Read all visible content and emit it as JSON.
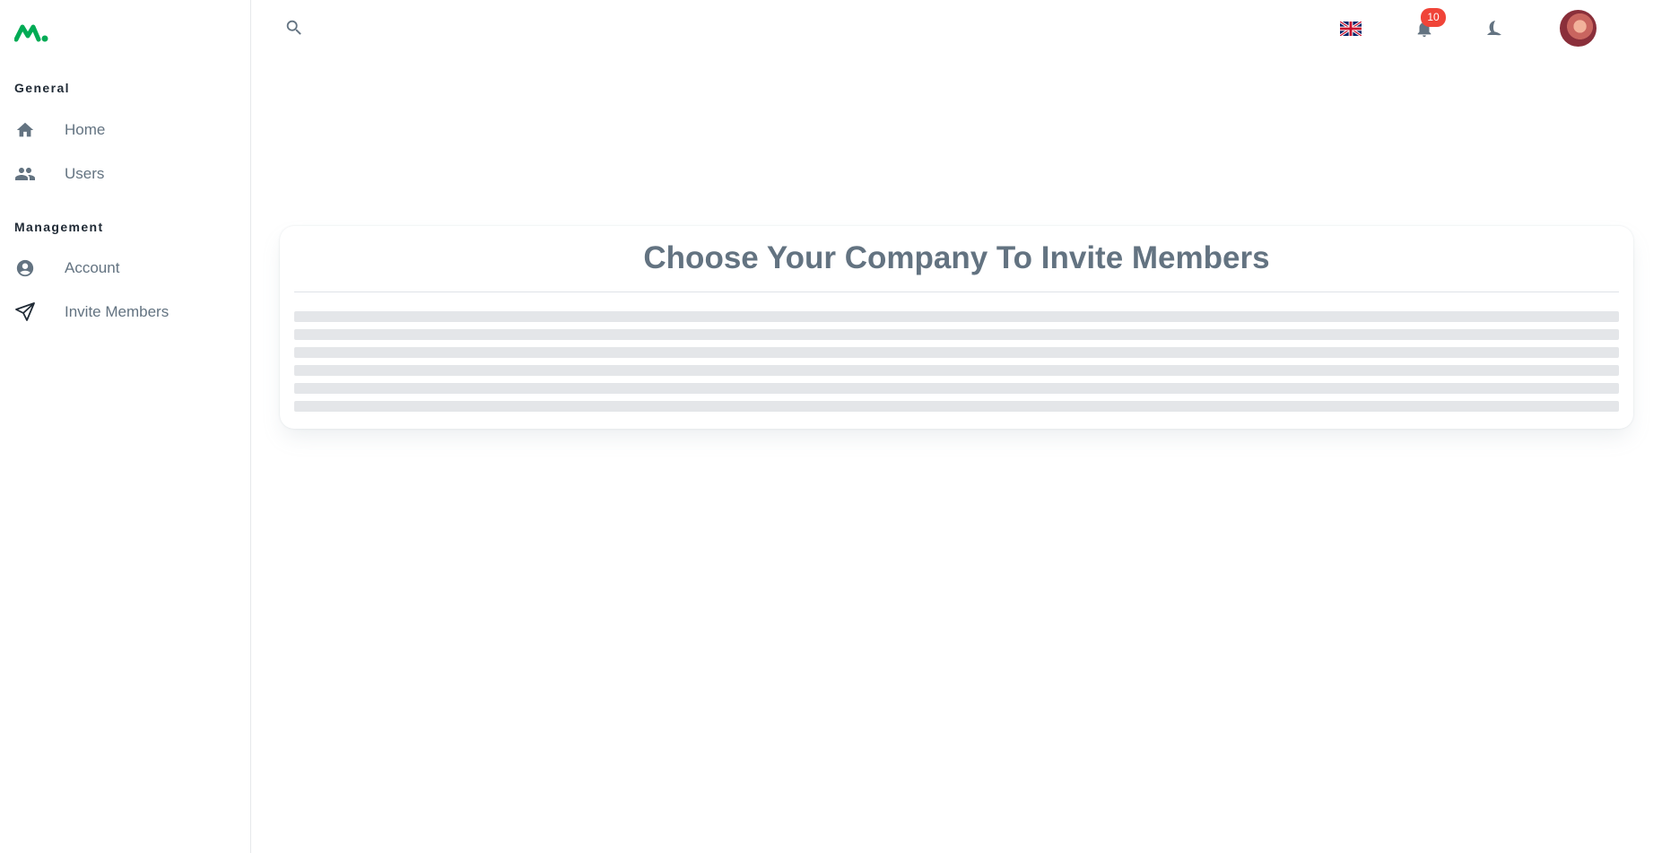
{
  "sidebar": {
    "logo": "minimal-logo",
    "sections": [
      {
        "title": "General",
        "items": [
          {
            "label": "Home",
            "icon": "home-icon"
          },
          {
            "label": "Users",
            "icon": "users-icon"
          }
        ]
      },
      {
        "title": "Management",
        "items": [
          {
            "label": "Account",
            "icon": "account-icon"
          },
          {
            "label": "Invite Members",
            "icon": "send-icon"
          }
        ]
      }
    ]
  },
  "topbar": {
    "search_icon": "search-icon",
    "language_icon": "uk-flag-icon",
    "notifications": {
      "icon": "bell-icon",
      "count": "10"
    },
    "theme_icon": "moon-icon",
    "avatar": "user-avatar"
  },
  "main": {
    "title": "Choose Your Company To Invite Members",
    "loading_rows": 6
  },
  "colors": {
    "brand_green": "#00ab55",
    "text_secondary": "#637381",
    "text_primary": "#212b36",
    "badge_red": "#f04438",
    "skeleton": "#e4e6e9"
  }
}
